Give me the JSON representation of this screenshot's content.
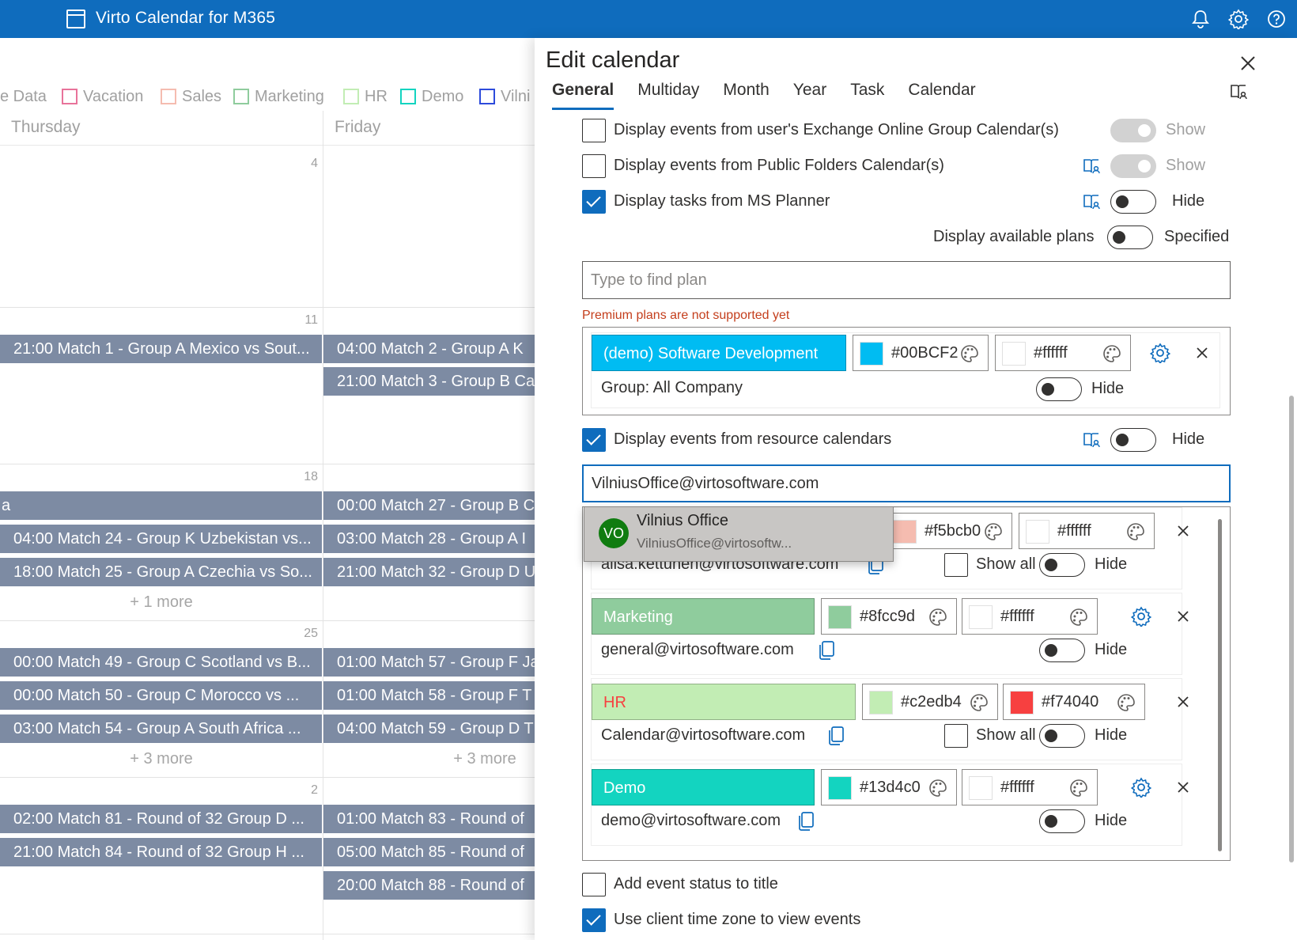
{
  "app": {
    "title": "Virto Calendar for M365"
  },
  "calendar": {
    "legend": [
      {
        "label": "e Data",
        "color": null
      },
      {
        "label": "Vacation",
        "color": "#e8739a"
      },
      {
        "label": "Sales",
        "color": "#f5bcb0"
      },
      {
        "label": "Marketing",
        "color": "#8fcc9d"
      },
      {
        "label": "HR",
        "color": "#c2edb4"
      },
      {
        "label": "Demo",
        "color": "#13d4c0"
      },
      {
        "label": "Vilni",
        "color": "#2d4bdb"
      }
    ],
    "days": [
      "Thursday",
      "Friday"
    ],
    "weeks": [
      {
        "num": "4"
      },
      {
        "num": "11",
        "thu": [
          "21:00 Match 1 - Group A Mexico vs Sout..."
        ],
        "fri": [
          "04:00 Match 2 - Group A K",
          "21:00 Match 3 - Group B Ca"
        ]
      },
      {
        "num": "18",
        "thu": [
          "a",
          "04:00 Match 24 - Group K Uzbekistan vs...",
          "18:00 Match 25 - Group A Czechia vs So..."
        ],
        "fri": [
          "00:00 Match 27 - Group B C",
          "03:00 Match 28 - Group A I",
          "21:00 Match 32 - Group D U"
        ],
        "thu_more": "+ 1 more"
      },
      {
        "num": "25",
        "thu": [
          "00:00 Match 49 - Group C Scotland vs B...",
          "00:00 Match 50 - Group C Morocco vs ...",
          "03:00 Match 54 - Group A South Africa ..."
        ],
        "fri": [
          "01:00 Match 57 - Group F Ja",
          "01:00 Match 58 - Group F T",
          "04:00 Match 59 - Group D T"
        ],
        "thu_more": "+ 3 more",
        "fri_more": "+ 3 more"
      },
      {
        "num": "2",
        "thu": [
          "02:00 Match 81 - Round of 32 Group D ...",
          "21:00 Match 84 - Round of 32 Group H ..."
        ],
        "fri": [
          "01:00 Match 83 - Round of",
          "05:00 Match 85 - Round of",
          "20:00 Match 88 - Round of"
        ]
      }
    ]
  },
  "panel": {
    "title": "Edit calendar",
    "tabs": [
      "General",
      "Multiday",
      "Month",
      "Year",
      "Task",
      "Calendar"
    ],
    "options": {
      "exchange_groups": {
        "label": "Display events from user's Exchange Online Group Calendar(s)",
        "toggle": "Show"
      },
      "public_folders": {
        "label": "Display events from Public Folders Calendar(s)",
        "toggle": "Show"
      },
      "ms_planner": {
        "label": "Display tasks from MS Planner",
        "toggle": "Hide"
      },
      "available_plans": {
        "label": "Display available plans",
        "toggle": "Specified"
      }
    },
    "plan_search": {
      "placeholder": "Type to find plan",
      "warning": "Premium plans are not supported yet"
    },
    "plan": {
      "name": "(demo) Software Development",
      "color": "#00BCF2",
      "text_color": "#ffffff",
      "group": "Group: All Company",
      "toggle": "Hide"
    },
    "resource": {
      "label": "Display events from resource calendars",
      "toggle": "Hide",
      "input_value": "VilniusOffice@virtosoftware.com"
    },
    "suggestion": {
      "initials": "VO",
      "name": "Vilnius Office",
      "email": "VilniusOffice@virtosoftw..."
    },
    "resources": [
      {
        "name": "",
        "color": "#f5bcb0",
        "text_color": "#ffffff",
        "email": "alisa.kettunen@virtosoftware.com",
        "show_all": "Show all",
        "toggle": "Hide",
        "name_text_color": "#ffffff",
        "has_gear": false
      },
      {
        "name": "Marketing",
        "color": "#8fcc9d",
        "text_color": "#ffffff",
        "email": "general@virtosoftware.com",
        "toggle": "Hide",
        "name_text_color": "#ffffff",
        "has_gear": true
      },
      {
        "name": "HR",
        "color": "#c2edb4",
        "text_color": "#f74040",
        "email": "Calendar@virtosoftware.com",
        "show_all": "Show all",
        "toggle": "Hide",
        "name_text_color": "#f74040",
        "has_gear": false
      },
      {
        "name": "Demo",
        "color": "#13d4c0",
        "text_color": "#ffffff",
        "email": "demo@virtosoftware.com",
        "toggle": "Hide",
        "name_text_color": "#ffffff",
        "has_gear": true
      }
    ],
    "bottom": {
      "event_status": {
        "label": "Add event status to title",
        "checked": false
      },
      "client_tz": {
        "label": "Use client time zone to view events",
        "checked": true
      }
    }
  }
}
